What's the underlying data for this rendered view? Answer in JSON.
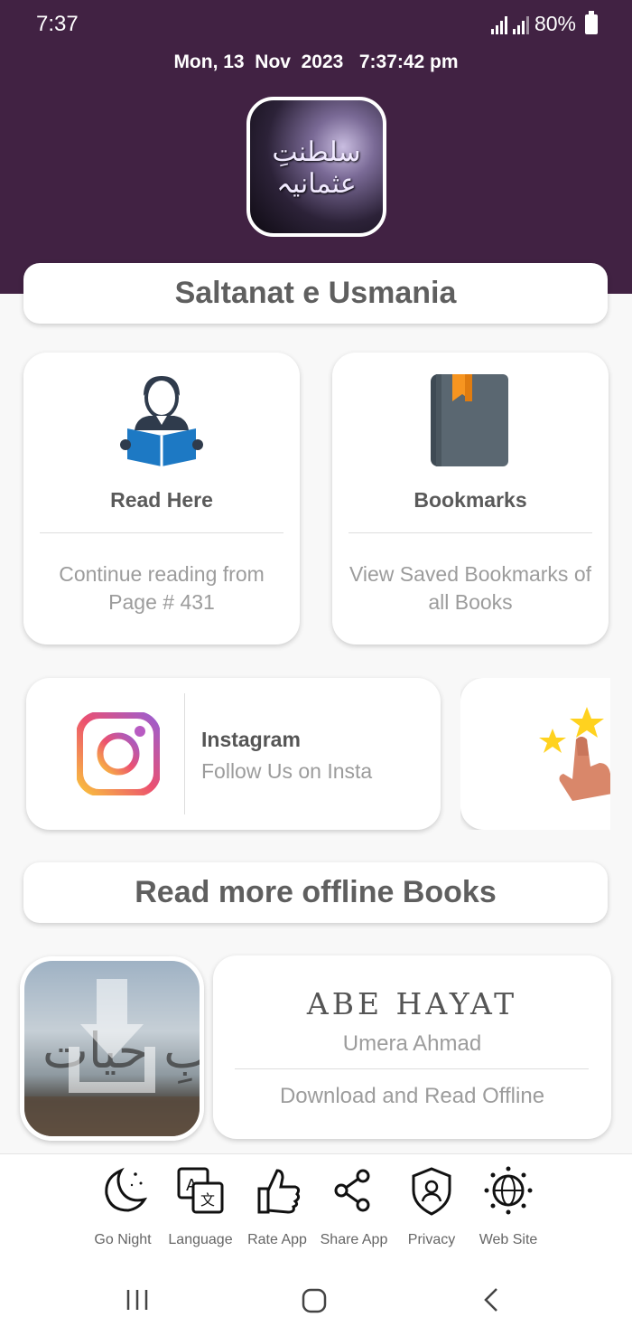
{
  "status_bar": {
    "time": "7:37",
    "battery": "80%"
  },
  "header": {
    "datetime": "Mon, 13  Nov  2023   7:37:42 pm",
    "logo_text": "سلطنتِ عثمانیہ"
  },
  "app_title": "Saltanat e Usmania",
  "tiles": {
    "read": {
      "title": "Read Here",
      "subtitle": "Continue reading from Page # 431"
    },
    "bookmarks": {
      "title": "Bookmarks",
      "subtitle": "View Saved Bookmarks of all Books"
    }
  },
  "social": {
    "title": "Instagram",
    "subtitle": "Follow Us on Insta"
  },
  "more_books_title": "Read more offline Books",
  "book": {
    "logo": "ABE HAYAT",
    "author": "Umera Ahmad",
    "action": "Download and Read Offline"
  },
  "bottom_nav": [
    {
      "label": "Go Night",
      "icon": "moon-icon"
    },
    {
      "label": "Language",
      "icon": "translate-icon"
    },
    {
      "label": "Rate App",
      "icon": "thumbs-up-icon"
    },
    {
      "label": "Share App",
      "icon": "share-icon"
    },
    {
      "label": "Privacy",
      "icon": "shield-user-icon"
    },
    {
      "label": "Web Site",
      "icon": "globe-icon"
    }
  ],
  "colors": {
    "header_bg": "#412243",
    "instagram_gradient": [
      "#f9a13c",
      "#e84a6a",
      "#a856c6"
    ]
  }
}
